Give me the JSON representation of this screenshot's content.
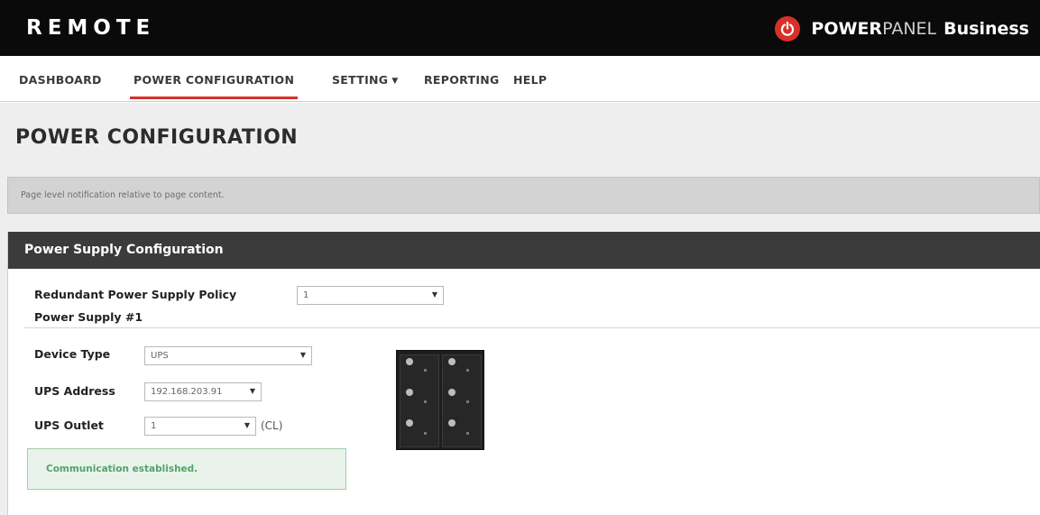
{
  "header": {
    "brand": "REMOTE",
    "product_strong": "POWER",
    "product_light": "PANEL",
    "product_suffix": "Business",
    "icon": "power-icon",
    "accent_color": "#d8312a"
  },
  "nav": {
    "items": [
      {
        "label": "DASHBOARD"
      },
      {
        "label": "POWER CONFIGURATION",
        "active": true
      },
      {
        "label": "SETTING",
        "has_dropdown": true
      },
      {
        "label": "REPORTING"
      },
      {
        "label": "HELP"
      }
    ]
  },
  "page": {
    "title": "POWER CONFIGURATION",
    "notification": "Page level notification relative to page content."
  },
  "panel": {
    "title": "Power Supply Configuration",
    "redundant_policy_label": "Redundant Power Supply Policy",
    "redundant_policy_value": "1",
    "power_supply_heading": "Power Supply #1",
    "device_type_label": "Device Type",
    "device_type_value": "UPS",
    "ups_address_label": "UPS Address",
    "ups_address_value": "192.168.203.91",
    "ups_outlet_label": "UPS Outlet",
    "ups_outlet_value": "1",
    "ups_outlet_unit": "(CL)",
    "status_message": "Communication established.",
    "status_color": "#52a46a"
  }
}
